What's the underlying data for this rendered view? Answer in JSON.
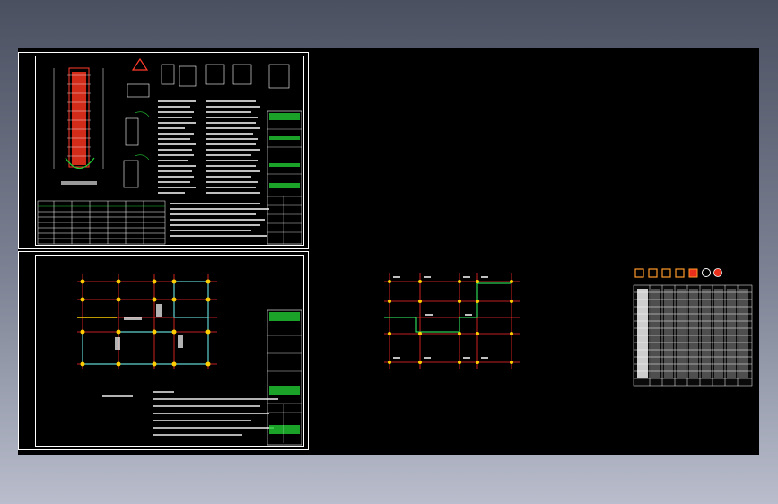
{
  "viewport": {
    "name": "cad-model-space",
    "background": "#000000"
  },
  "colors": {
    "sheet_border": "#ffffff",
    "grid_red": "#ff2a2a",
    "column_yellow": "#ffcc00",
    "beam_cyan": "#5fd3d0",
    "highlight_green": "#33ff66",
    "pile_red": "#e8301c",
    "title_block_green": "#22cc33",
    "table_white": "#ffffff"
  },
  "sheets": {
    "detail_sheet": {
      "label": "sheet-pile-details"
    },
    "plan_sheet": {
      "label": "sheet-foundation-plan"
    },
    "grid_plan": {
      "label": "column-grid-plan"
    },
    "schedule": {
      "label": "pile-schedule-table"
    }
  },
  "legend_symbols": [
    "orange-square",
    "orange-square",
    "orange-square",
    "orange-square",
    "red-square",
    "white-circle",
    "red-circle"
  ]
}
